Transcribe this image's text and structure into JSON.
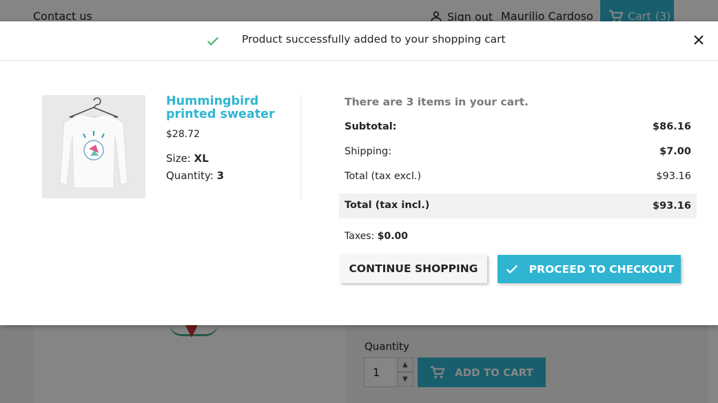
{
  "background_page": {
    "contact_link": "Contact us",
    "sign_out_label": "Sign out",
    "user_name": "Maurilio Cardoso",
    "cart_label": "Cart",
    "cart_count": "(3)",
    "quantity_label": "Quantity",
    "quantity_value": "1",
    "add_to_cart_label": "ADD TO CART"
  },
  "modal": {
    "header_message": "Product successfully added to your shopping cart",
    "product": {
      "name": "Hummingbird printed sweater",
      "price": "$28.72",
      "size_label": "Size:",
      "size_value": "XL",
      "quantity_label": "Quantity:",
      "quantity_value": "3"
    },
    "cart_summary": {
      "items_message": "There are 3 items in your cart.",
      "subtotal_label": "Subtotal:",
      "subtotal_value": "$86.16",
      "shipping_label": "Shipping:",
      "shipping_value": "$7.00",
      "total_excl_label": "Total (tax excl.)",
      "total_excl_value": "$93.16",
      "total_incl_label": "Total (tax incl.)",
      "total_incl_value": "$93.16",
      "taxes_label": "Taxes:",
      "taxes_value": "$0.00"
    },
    "buttons": {
      "continue_label": "CONTINUE SHOPPING",
      "checkout_label": "PROCEED TO CHECKOUT"
    }
  },
  "colors": {
    "accent": "#2fb5d2",
    "text": "#232323",
    "muted": "#7a7a7a"
  }
}
